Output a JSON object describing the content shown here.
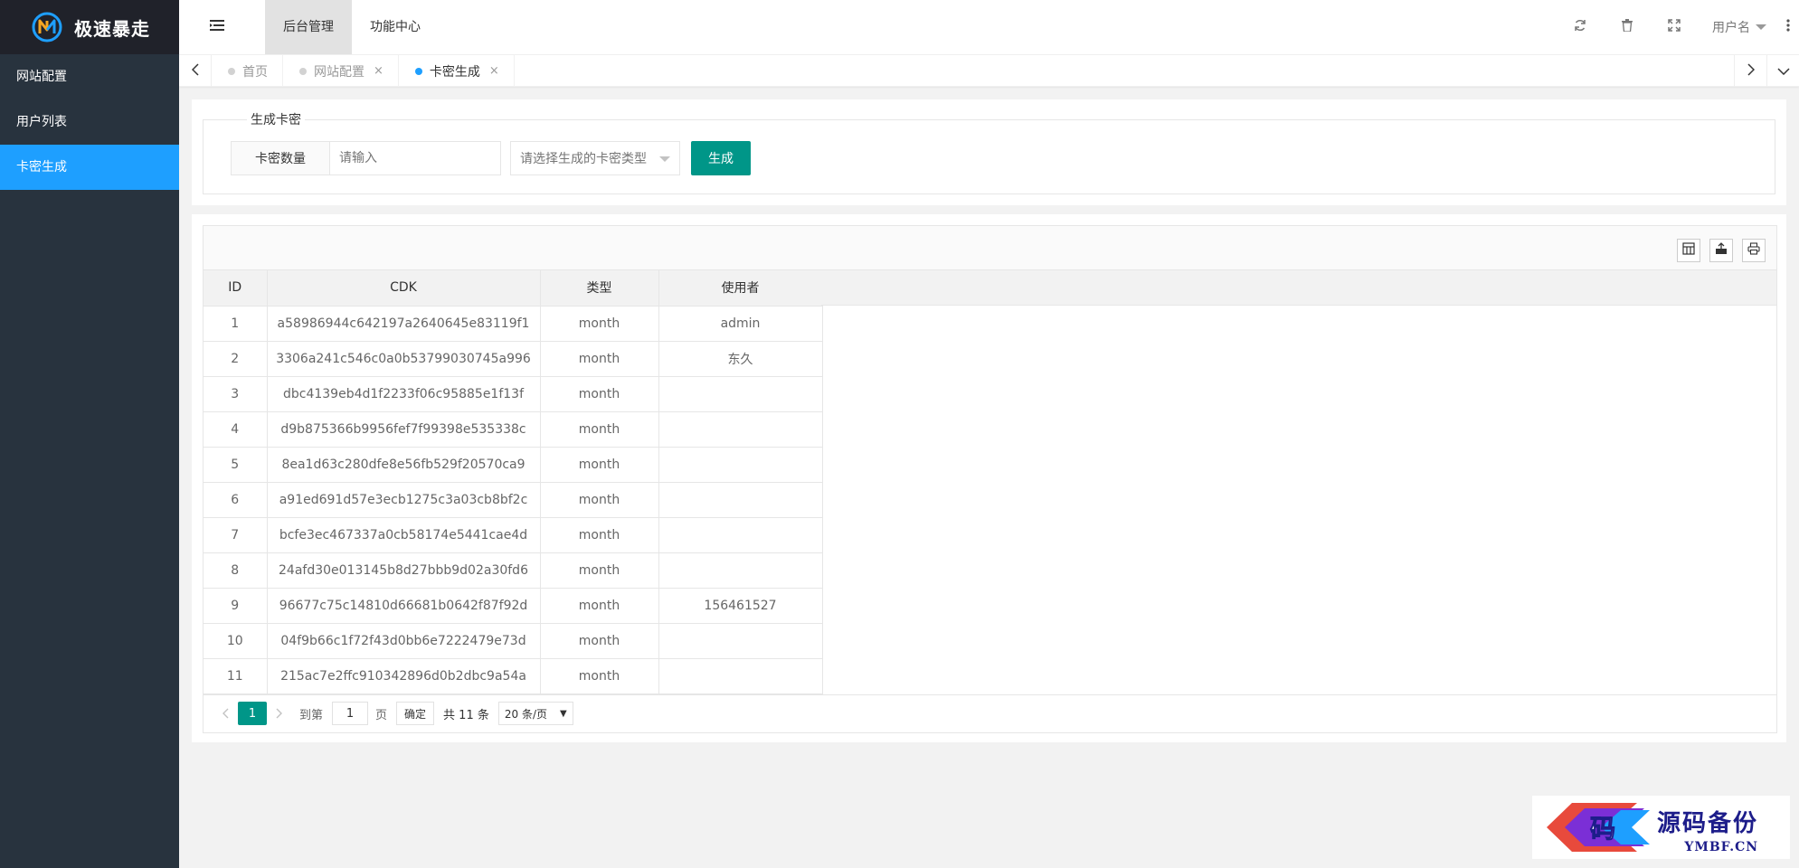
{
  "app": {
    "logo_text": "极速暴走"
  },
  "sidebar": {
    "items": [
      {
        "label": "网站配置"
      },
      {
        "label": "用户列表"
      },
      {
        "label": "卡密生成"
      }
    ]
  },
  "header": {
    "nav": [
      {
        "label": "后台管理"
      },
      {
        "label": "功能中心"
      }
    ],
    "user_label": "用户名"
  },
  "tabs": [
    {
      "label": "首页"
    },
    {
      "label": "网站配置",
      "close": "×"
    },
    {
      "label": "卡密生成",
      "close": "×"
    }
  ],
  "generate": {
    "legend": "生成卡密",
    "count_label": "卡密数量",
    "count_placeholder": "请输入",
    "type_placeholder": "请选择生成的卡密类型",
    "submit_label": "生成"
  },
  "table": {
    "columns": [
      "ID",
      "CDK",
      "类型",
      "使用者"
    ],
    "rows": [
      [
        "1",
        "a58986944c642197a2640645e83119f1",
        "month",
        "admin"
      ],
      [
        "2",
        "3306a241c546c0a0b53799030745a996",
        "month",
        "东久"
      ],
      [
        "3",
        "dbc4139eb4d1f2233f06c95885e1f13f",
        "month",
        ""
      ],
      [
        "4",
        "d9b875366b9956fef7f99398e535338c",
        "month",
        ""
      ],
      [
        "5",
        "8ea1d63c280dfe8e56fb529f20570ca9",
        "month",
        ""
      ],
      [
        "6",
        "a91ed691d57e3ecb1275c3a03cb8bf2c",
        "month",
        ""
      ],
      [
        "7",
        "bcfe3ec467337a0cb58174e5441cae4d",
        "month",
        ""
      ],
      [
        "8",
        "24afd30e013145b8d27bbb9d02a30fd6",
        "month",
        ""
      ],
      [
        "9",
        "96677c75c14810d66681b0642f87f92d",
        "month",
        "156461527"
      ],
      [
        "10",
        "04f9b66c1f72f43d0bb6e7222479e73d",
        "month",
        ""
      ],
      [
        "11",
        "215ac7e2ffc910342896d0b2dbc9a54a",
        "month",
        ""
      ]
    ]
  },
  "pager": {
    "current": "1",
    "skip_prefix": "到第",
    "skip_value": "1",
    "skip_suffix": "页",
    "ok_label": "确定",
    "count_text": "共 11 条",
    "limit_text": "20 条/页"
  },
  "watermark": {
    "badge_char": "码",
    "cn": "源码备份",
    "en": "YMBF.CN"
  },
  "colors": {
    "sidebar_bg": "#28333e",
    "logo_bg": "#20222a",
    "accent_blue": "#1e9fff",
    "primary_green": "#009688"
  }
}
